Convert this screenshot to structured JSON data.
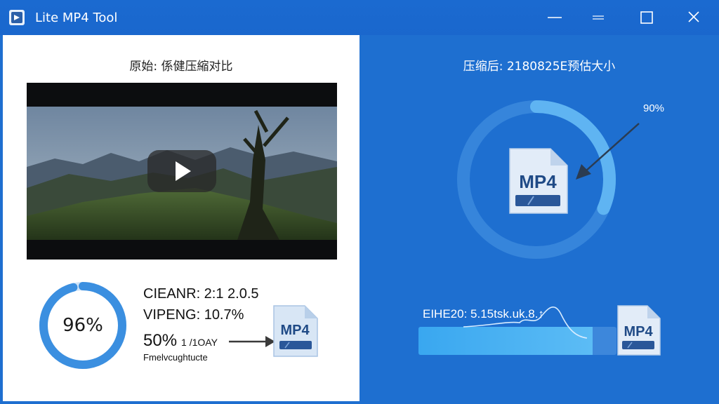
{
  "window": {
    "title": "Lite MP4 Tool"
  },
  "left": {
    "title": "原始: 係健压縮对比",
    "ring_percent_label": "96%",
    "ring_value": 0.96,
    "stats": [
      "CIEANR: 2:1 2.0.5",
      "VIPENG: 10.7%",
      "50%",
      "1 /1OAY",
      "Fmelvcughtucte"
    ],
    "file_label": "MP4"
  },
  "right": {
    "title": "压缩后: 2180825E预估大小",
    "percent_label": "90%",
    "ring_value": 0.9,
    "file_label": "MP4",
    "bottom_label": "EIHE20: 5.15tsk.uk.8.↑",
    "bottom_file_label": "MP4",
    "progress_value": 0.88
  },
  "colors": {
    "accent": "#1e6fd0",
    "ring": "#4aa6ee",
    "left_ring": "#3b8fe0"
  }
}
